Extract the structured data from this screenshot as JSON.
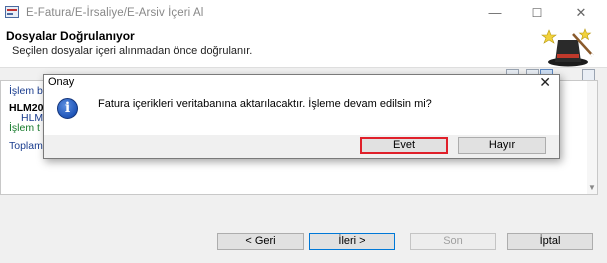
{
  "window": {
    "title": "E-Fatura/E-İrsaliye/E-Arsiv İçeri Al",
    "controls": {
      "minimize": "—",
      "maximize": "☐",
      "close": "✕"
    }
  },
  "header": {
    "title": "Dosyalar Doğrulanıyor",
    "subtitle": "Seçilen dosyalar içeri alınmadan önce doğrulanır."
  },
  "log": {
    "line1": "İşlem b",
    "line2": "HLM20",
    "line3": "HLM",
    "line4": "İşlem t",
    "line5": "Toplam"
  },
  "buttons": {
    "back": "< Geri",
    "next": "İleri >",
    "finish": "Son",
    "cancel": "İptal"
  },
  "dialog": {
    "title": "Onay",
    "close": "✕",
    "message": "Fatura içerikleri veritabanına aktarılacaktır. İşleme devam edilsin mi?",
    "info_glyph": "i",
    "yes": "Evet",
    "no": "Hayır"
  },
  "colors": {
    "highlight_border": "#e0202a",
    "info_blue": "#1f55b8",
    "log_blue": "#1a3d8f",
    "log_green": "#157a2b"
  },
  "icons": [
    "app-icon",
    "wizard-hat-icon",
    "info-icon",
    "close-icon"
  ]
}
